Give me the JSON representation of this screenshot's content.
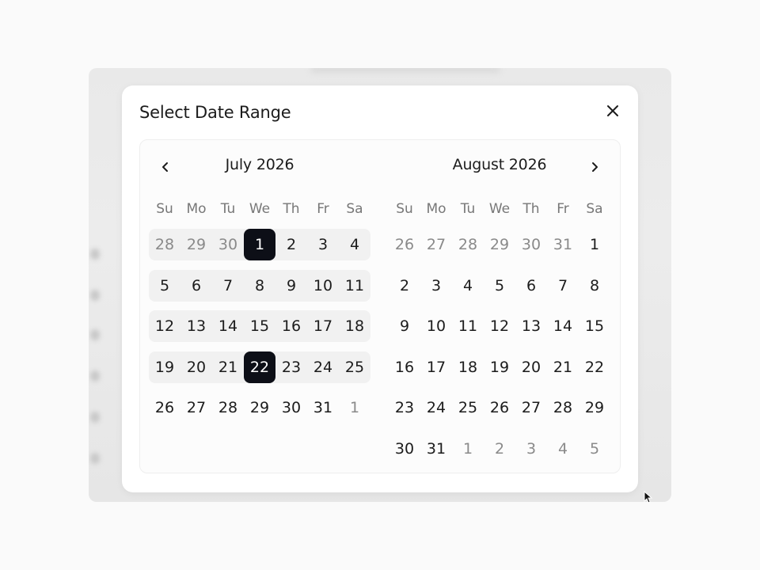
{
  "dialog": {
    "title": "Select Date Range",
    "close_icon": "close-icon"
  },
  "colors": {
    "selected_bg": "#0d0f17",
    "range_bg": "#f1f1f1",
    "outside_text": "#8a8a8a"
  },
  "calendar": {
    "prev_icon": "chevron-left-icon",
    "next_icon": "chevron-right-icon",
    "weekdays": [
      "Su",
      "Mo",
      "Tu",
      "We",
      "Th",
      "Fr",
      "Sa"
    ],
    "left": {
      "title": "July 2026",
      "weeks": [
        [
          {
            "d": "28",
            "o": true
          },
          {
            "d": "29",
            "o": true
          },
          {
            "d": "30",
            "o": true
          },
          {
            "d": "1",
            "s": true
          },
          {
            "d": "2"
          },
          {
            "d": "3"
          },
          {
            "d": "4"
          }
        ],
        [
          {
            "d": "5"
          },
          {
            "d": "6"
          },
          {
            "d": "7"
          },
          {
            "d": "8"
          },
          {
            "d": "9"
          },
          {
            "d": "10"
          },
          {
            "d": "11"
          }
        ],
        [
          {
            "d": "12"
          },
          {
            "d": "13"
          },
          {
            "d": "14"
          },
          {
            "d": "15"
          },
          {
            "d": "16"
          },
          {
            "d": "17"
          },
          {
            "d": "18"
          }
        ],
        [
          {
            "d": "19"
          },
          {
            "d": "20"
          },
          {
            "d": "21"
          },
          {
            "d": "22",
            "s": true
          },
          {
            "d": "23"
          },
          {
            "d": "24"
          },
          {
            "d": "25"
          }
        ],
        [
          {
            "d": "26"
          },
          {
            "d": "27"
          },
          {
            "d": "28"
          },
          {
            "d": "29"
          },
          {
            "d": "30"
          },
          {
            "d": "31"
          },
          {
            "d": "1",
            "o": true
          }
        ]
      ]
    },
    "right": {
      "title": "August 2026",
      "weeks": [
        [
          {
            "d": "26",
            "o": true
          },
          {
            "d": "27",
            "o": true
          },
          {
            "d": "28",
            "o": true
          },
          {
            "d": "29",
            "o": true
          },
          {
            "d": "30",
            "o": true
          },
          {
            "d": "31",
            "o": true
          },
          {
            "d": "1"
          }
        ],
        [
          {
            "d": "2"
          },
          {
            "d": "3"
          },
          {
            "d": "4"
          },
          {
            "d": "5"
          },
          {
            "d": "6"
          },
          {
            "d": "7"
          },
          {
            "d": "8"
          }
        ],
        [
          {
            "d": "9"
          },
          {
            "d": "10"
          },
          {
            "d": "11"
          },
          {
            "d": "12"
          },
          {
            "d": "13"
          },
          {
            "d": "14"
          },
          {
            "d": "15"
          }
        ],
        [
          {
            "d": "16"
          },
          {
            "d": "17"
          },
          {
            "d": "18"
          },
          {
            "d": "19"
          },
          {
            "d": "20"
          },
          {
            "d": "21"
          },
          {
            "d": "22"
          }
        ],
        [
          {
            "d": "23"
          },
          {
            "d": "24"
          },
          {
            "d": "25"
          },
          {
            "d": "26"
          },
          {
            "d": "27"
          },
          {
            "d": "28"
          },
          {
            "d": "29"
          }
        ],
        [
          {
            "d": "30"
          },
          {
            "d": "31"
          },
          {
            "d": "1",
            "o": true
          },
          {
            "d": "2",
            "o": true
          },
          {
            "d": "3",
            "o": true
          },
          {
            "d": "4",
            "o": true
          },
          {
            "d": "5",
            "o": true
          }
        ]
      ]
    },
    "range_weeks_left": [
      0,
      1,
      2,
      3
    ]
  }
}
